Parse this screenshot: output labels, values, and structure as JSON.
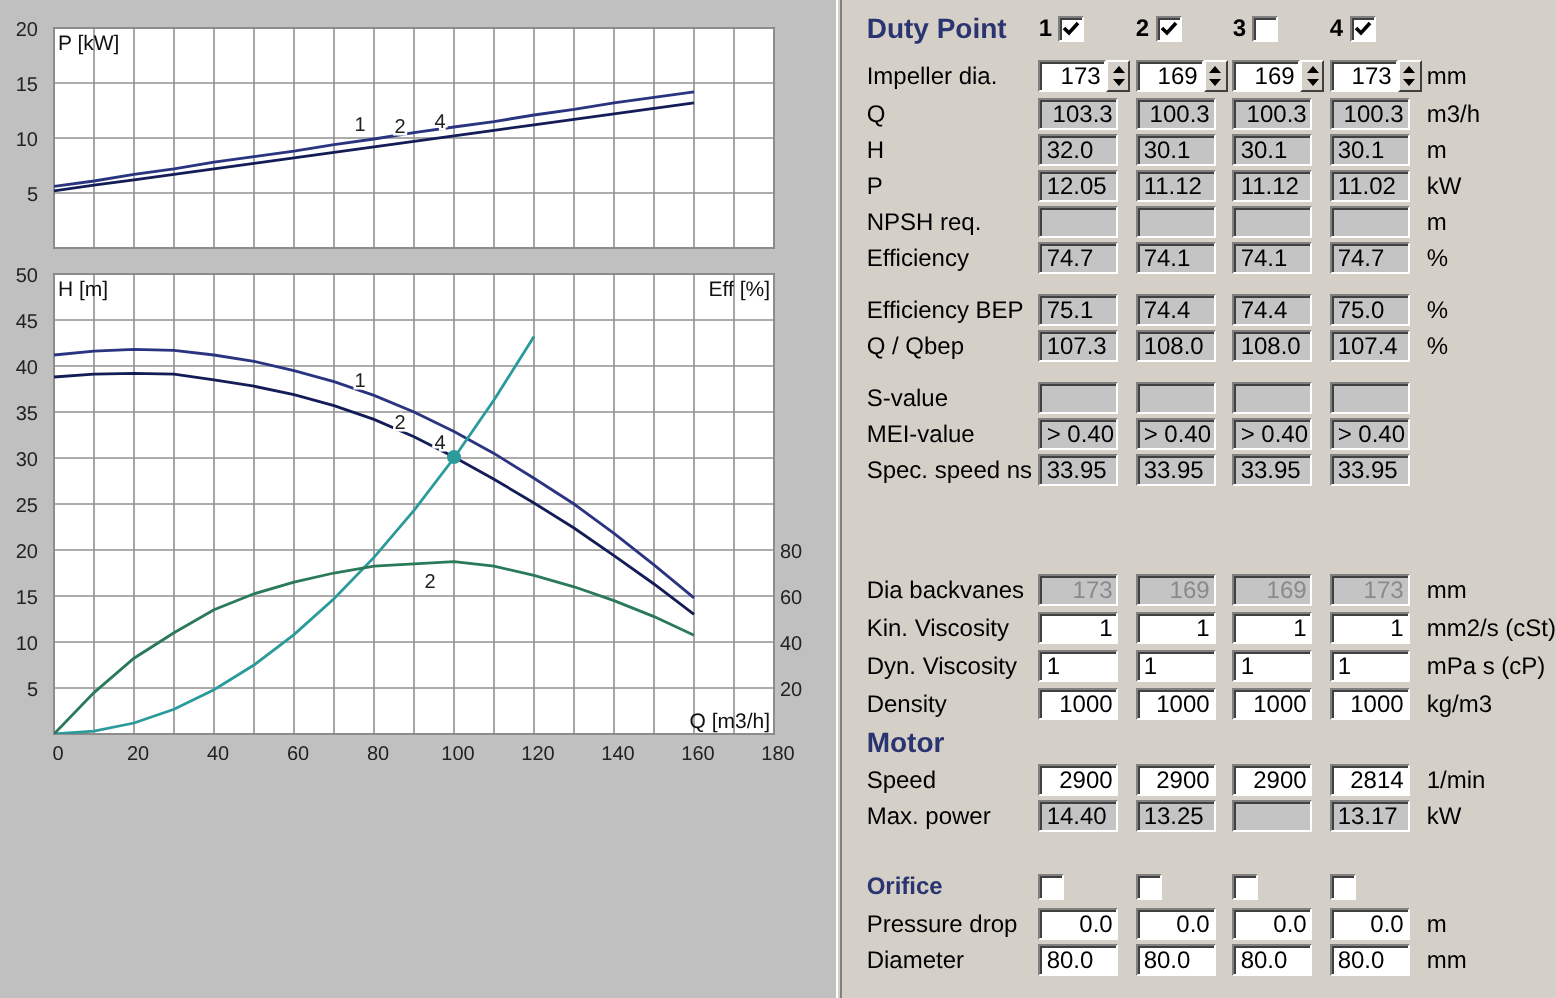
{
  "charts": [
    {
      "chart_data": {
        "type": "line",
        "ylabel": "P [kW]",
        "x": [
          0,
          10,
          20,
          30,
          40,
          50,
          60,
          70,
          80,
          90,
          100,
          110,
          120,
          130,
          140,
          150,
          160
        ],
        "xlim": [
          0,
          180
        ],
        "ylim": [
          0,
          20
        ],
        "yticks": [
          5,
          10,
          15,
          20
        ],
        "grid": true,
        "series": [
          {
            "color": "#2a3480",
            "values": [
              5.6,
              6.1,
              6.7,
              7.2,
              7.8,
              8.3,
              8.8,
              9.4,
              9.9,
              10.5,
              11.0,
              11.5,
              12.1,
              12.6,
              13.2,
              13.7,
              14.2
            ]
          },
          {
            "color": "#141c58",
            "values": [
              5.2,
              5.7,
              6.2,
              6.7,
              7.2,
              7.7,
              8.2,
              8.7,
              9.2,
              9.7,
              10.2,
              10.7,
              11.2,
              11.7,
              12.2,
              12.7,
              13.2
            ]
          }
        ],
        "annotations": [
          {
            "x": 80,
            "y": 9.9,
            "text": "1"
          },
          {
            "x": 90,
            "y": 9.7,
            "text": "2"
          },
          {
            "x": 100,
            "y": 10.2,
            "text": "4"
          }
        ]
      }
    },
    {
      "chart_data": {
        "type": "line",
        "ylabel": "H [m]",
        "xlabel": "Q [m3/h]",
        "y2label": "Eff [%]",
        "x": [
          0,
          10,
          20,
          30,
          40,
          50,
          60,
          70,
          80,
          90,
          100,
          110,
          120,
          130,
          140,
          150,
          160
        ],
        "xlim": [
          0,
          180
        ],
        "ylim": [
          0,
          50
        ],
        "y2lim": [
          0,
          200
        ],
        "xticks": [
          0,
          20,
          40,
          60,
          80,
          100,
          120,
          140,
          160,
          180
        ],
        "yticks": [
          5,
          10,
          15,
          20,
          25,
          30,
          35,
          40,
          45,
          50
        ],
        "y2ticks": [
          20,
          40,
          60,
          80
        ],
        "grid": true,
        "series": [
          {
            "color": "#2a3480",
            "values": [
              41.2,
              41.6,
              41.8,
              41.7,
              41.2,
              40.5,
              39.5,
              38.3,
              36.8,
              35.0,
              32.9,
              30.5,
              27.8,
              25.0,
              21.8,
              18.4,
              14.8
            ]
          },
          {
            "color": "#141c58",
            "values": [
              38.8,
              39.1,
              39.2,
              39.1,
              38.5,
              37.8,
              36.9,
              35.7,
              34.2,
              32.3,
              30.1,
              27.7,
              25.1,
              22.4,
              19.4,
              16.3,
              13.0
            ]
          },
          {
            "color": "#2a9a9a",
            "values": [
              0,
              0.3,
              1.2,
              2.7,
              4.8,
              7.5,
              10.8,
              14.7,
              19.2,
              24.3,
              30.0,
              36.3,
              43.2,
              null,
              null,
              null,
              null
            ]
          },
          {
            "color": "#2a7a5a",
            "axis": "y2",
            "values": [
              0,
              18,
              33,
              44,
              54,
              61,
              66,
              70,
              73,
              74,
              75,
              73,
              69,
              64,
              58,
              51,
              43
            ]
          }
        ],
        "annotations": [
          {
            "x": 80,
            "y": 36.8,
            "text": "1"
          },
          {
            "x": 90,
            "y": 32.3,
            "text": "2"
          },
          {
            "x": 100,
            "y": 30.1,
            "text": "4"
          },
          "2"
        ]
      }
    }
  ],
  "duty_point": {
    "title": "Duty Point",
    "points": [
      {
        "label": "1",
        "checked": true
      },
      {
        "label": "2",
        "checked": true
      },
      {
        "label": "3",
        "checked": false
      },
      {
        "label": "4",
        "checked": true
      }
    ],
    "groups": [
      [
        {
          "label": "Impeller dia.",
          "kind": "spin",
          "cells": [
            {
              "text": "173"
            },
            {
              "text": "169"
            },
            {
              "text": "169"
            },
            {
              "text": "173"
            }
          ],
          "unit": "mm"
        },
        {
          "label": "Q",
          "kind": "output",
          "cells": [
            {
              "text": "103.3"
            },
            {
              "text": "100.3"
            },
            {
              "text": "100.3"
            },
            {
              "text": "100.3"
            }
          ],
          "unit": "m3/h"
        },
        {
          "label": "H",
          "kind": "output-left",
          "cells": [
            {
              "text": "32.0"
            },
            {
              "text": "30.1"
            },
            {
              "text": "30.1"
            },
            {
              "text": "30.1"
            }
          ],
          "unit": "m"
        },
        {
          "label": "P",
          "kind": "output-left",
          "cells": [
            {
              "text": "12.05"
            },
            {
              "text": "11.12"
            },
            {
              "text": "11.12"
            },
            {
              "text": "11.02"
            }
          ],
          "unit": "kW"
        },
        {
          "label": "NPSH req.",
          "kind": "output-left",
          "unit": "m"
        },
        {
          "label": "Efficiency",
          "kind": "output-left",
          "cells": [
            {
              "text": "74.7"
            },
            {
              "text": "74.1"
            },
            {
              "text": "74.1"
            },
            {
              "text": "74.7"
            }
          ],
          "unit": "%"
        }
      ],
      [
        {
          "label": "Efficiency BEP",
          "kind": "output-left",
          "cells": [
            {
              "text": "75.1"
            },
            {
              "text": "74.4"
            },
            {
              "text": "74.4"
            },
            {
              "text": "75.0"
            }
          ],
          "unit": "%"
        },
        {
          "label": "Q / Qbep",
          "kind": "output-left",
          "cells": [
            {
              "text": "107.3"
            },
            {
              "text": "108.0"
            },
            {
              "text": "108.0"
            },
            {
              "text": "107.4"
            }
          ],
          "unit": "%"
        }
      ],
      [
        {
          "label": "S-value",
          "kind": "output-left"
        },
        {
          "label": "MEI-value",
          "kind": "output-left",
          "cells": [
            {
              "text": "> 0.40"
            },
            {
              "text": "> 0.40"
            },
            {
              "text": "> 0.40"
            },
            {
              "text": "> 0.40"
            }
          ]
        },
        {
          "label": "Spec. speed ns",
          "kind": "output-left",
          "cells": [
            {
              "text": "33.95"
            },
            {
              "text": "33.95"
            },
            {
              "text": "33.95"
            },
            {
              "text": "33.95"
            }
          ]
        }
      ]
    ]
  },
  "fluid": {
    "rows": [
      {
        "label": "Dia backvanes",
        "kind": "disabled",
        "cells": [
          {
            "text": "173"
          },
          {
            "text": "169"
          },
          {
            "text": "169"
          },
          {
            "text": "173"
          }
        ],
        "unit": "mm"
      },
      {
        "label": "Kin. Viscosity",
        "kind": "input",
        "cells": [
          {
            "text": "1"
          },
          {
            "text": "1"
          },
          {
            "text": "1"
          },
          {
            "text": "1"
          }
        ],
        "unit": "mm2/s (cSt)"
      },
      {
        "label": "Dyn. Viscosity",
        "kind": "input-left",
        "cells": [
          {
            "text": "1"
          },
          {
            "text": "1"
          },
          {
            "text": "1"
          },
          {
            "text": "1"
          }
        ],
        "unit": "mPa s (cP)"
      },
      {
        "label": "Density",
        "kind": "input",
        "cells": [
          {
            "text": "1000"
          },
          {
            "text": "1000"
          },
          {
            "text": "1000"
          },
          {
            "text": "1000"
          }
        ],
        "unit": "kg/m3"
      }
    ]
  },
  "motor": {
    "title": "Motor",
    "rows": [
      {
        "label": "Speed",
        "kind": "input",
        "cells": [
          {
            "text": "2900"
          },
          {
            "text": "2900"
          },
          {
            "text": "2900"
          },
          {
            "text": "2814"
          }
        ],
        "unit": "1/min"
      },
      {
        "label": "Max. power",
        "kind": "output-left",
        "cells": [
          {
            "text": "14.40"
          },
          {
            "text": "13.25"
          },
          {},
          {
            "text": "13.17"
          }
        ],
        "unit": "kW"
      }
    ]
  },
  "orifice": {
    "title": "Orifice",
    "checks": [
      {
        "checked": false
      },
      {
        "checked": false
      },
      {
        "checked": false
      },
      {
        "checked": false
      }
    ],
    "rows": [
      {
        "label": "Pressure drop",
        "kind": "input",
        "cells": [
          {
            "text": "0.0"
          },
          {
            "text": "0.0"
          },
          {
            "text": "0.0"
          },
          {
            "text": "0.0"
          }
        ],
        "unit": "m"
      },
      {
        "label": "Diameter",
        "kind": "input-left",
        "cells": [
          {
            "text": "80.0"
          },
          {
            "text": "80.0"
          },
          {
            "text": "80.0"
          },
          {
            "text": "80.0"
          }
        ],
        "unit": "mm"
      }
    ]
  }
}
